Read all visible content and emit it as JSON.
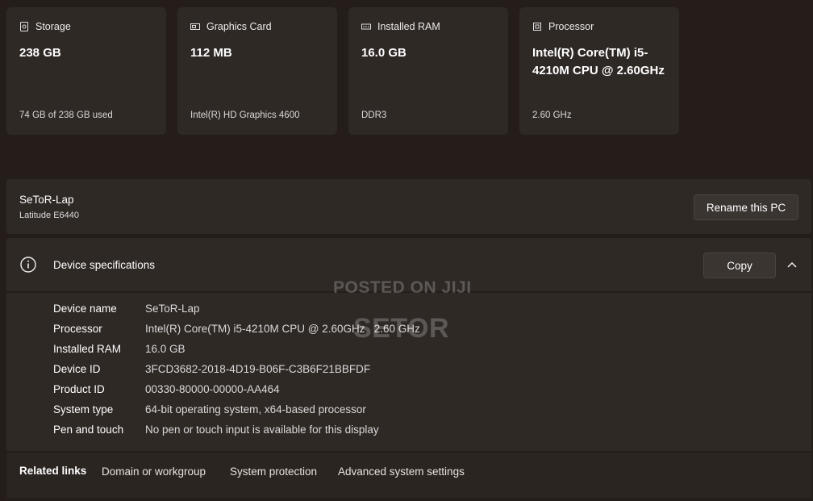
{
  "cards": [
    {
      "icon": "storage-icon",
      "label": "Storage",
      "value": "238 GB",
      "sub": "74 GB of 238 GB used"
    },
    {
      "icon": "graphics-card-icon",
      "label": "Graphics Card",
      "value": "112 MB",
      "sub": "Intel(R) HD Graphics 4600"
    },
    {
      "icon": "ram-icon",
      "label": "Installed RAM",
      "value": "16.0 GB",
      "sub": "DDR3"
    },
    {
      "icon": "processor-icon",
      "label": "Processor",
      "value": "Intel(R) Core(TM) i5-4210M CPU @ 2.60GHz",
      "sub": "2.60 GHz"
    }
  ],
  "pc": {
    "name": "SeToR-Lap",
    "model": "Latitude E6440",
    "rename_label": "Rename this PC"
  },
  "specs": {
    "title": "Device specifications",
    "copy_label": "Copy",
    "rows": [
      {
        "label": "Device name",
        "value": "SeToR-Lap"
      },
      {
        "label": "Processor",
        "value": "Intel(R) Core(TM) i5-4210M CPU @ 2.60GHz   2.60 GHz"
      },
      {
        "label": "Installed RAM",
        "value": "16.0 GB"
      },
      {
        "label": "Device ID",
        "value": "3FCD3682-2018-4D19-B06F-C3B6F21BBFDF"
      },
      {
        "label": "Product ID",
        "value": "00330-80000-00000-AA464"
      },
      {
        "label": "System type",
        "value": "64-bit operating system, x64-based processor"
      },
      {
        "label": "Pen and touch",
        "value": "No pen or touch input is available for this display"
      }
    ]
  },
  "related": {
    "label": "Related links",
    "links": [
      "Domain or workgroup",
      "System protection",
      "Advanced system settings"
    ]
  },
  "watermark": {
    "line1": "POSTED ON JIJI",
    "line2": "SETOR"
  }
}
